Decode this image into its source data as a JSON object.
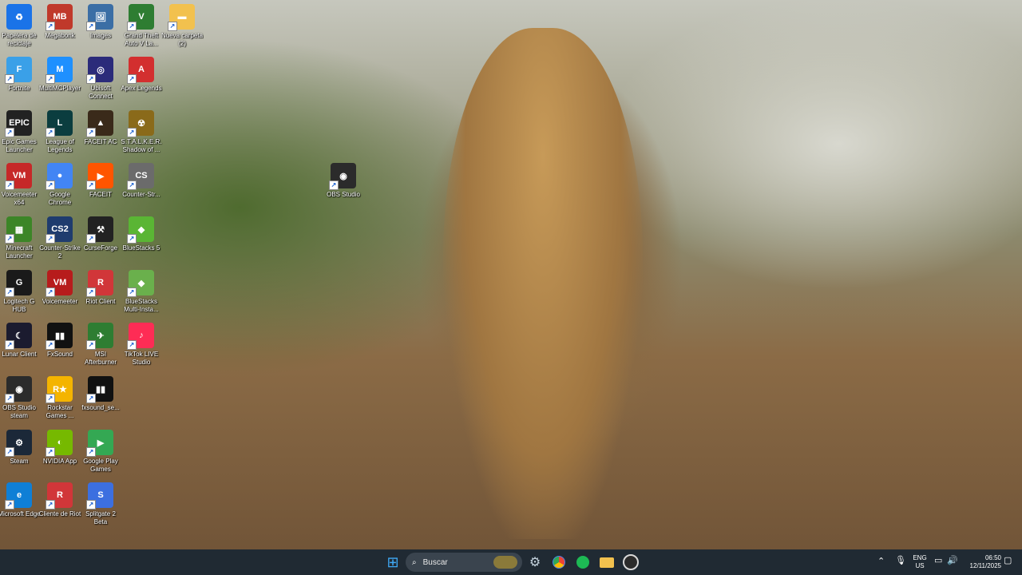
{
  "desktop": {
    "icons": [
      {
        "label": "Papelera de reciclaje",
        "icon": "recycle-bin-icon",
        "glyph": "♻",
        "color": "#1a73e8"
      },
      {
        "label": "Megabonk",
        "icon": "megabonk-icon",
        "glyph": "MB",
        "color": "#c0392b"
      },
      {
        "label": "Images",
        "icon": "images-icon",
        "glyph": "🖼",
        "color": "#3b6ea5"
      },
      {
        "label": "Grand Theft Auto V La...",
        "icon": "gta-icon",
        "glyph": "V",
        "color": "#2e7d32"
      },
      {
        "label": "Nueva carpeta (2)",
        "icon": "folder-icon",
        "glyph": "▬",
        "color": "#f2c14e"
      },
      {
        "label": "Fortnite",
        "icon": "fortnite-icon",
        "glyph": "F",
        "color": "#3aa0e8"
      },
      {
        "label": "MultiMCPlayer",
        "icon": "multimc-icon",
        "glyph": "M",
        "color": "#1e90ff"
      },
      {
        "label": "Ubisoft Connect",
        "icon": "ubisoft-icon",
        "glyph": "◎",
        "color": "#2b2b7a"
      },
      {
        "label": "Apex Legends",
        "icon": "apex-icon",
        "glyph": "A",
        "color": "#d32f2f"
      },
      {
        "label": "Epic Games Launcher",
        "icon": "epic-games-icon",
        "glyph": "EPIC",
        "color": "#222222"
      },
      {
        "label": "League of Legends",
        "icon": "league-icon",
        "glyph": "L",
        "color": "#0b3d3f"
      },
      {
        "label": "FACEIT AC",
        "icon": "faceit-ac-icon",
        "glyph": "▲",
        "color": "#3a2a1a"
      },
      {
        "label": "S.T.A.L.K.E.R. Shadow of ...",
        "icon": "stalker-icon",
        "glyph": "☢",
        "color": "#8a6a1a"
      },
      {
        "label": "Voicemeeter x64",
        "icon": "voicemeeter-icon",
        "glyph": "VM",
        "color": "#c62828"
      },
      {
        "label": "Google Chrome",
        "icon": "chrome-icon",
        "glyph": "●",
        "color": "#4285f4"
      },
      {
        "label": "FACEIT",
        "icon": "faceit-icon",
        "glyph": "▶",
        "color": "#ff5500"
      },
      {
        "label": "Counter-Str...",
        "icon": "counter-strike-icon",
        "glyph": "CS",
        "color": "#6b6b6b"
      },
      {
        "label": "Minecraft Launcher",
        "icon": "minecraft-icon",
        "glyph": "▦",
        "color": "#3c8527"
      },
      {
        "label": "Counter-Strike 2",
        "icon": "cs2-icon",
        "glyph": "CS2",
        "color": "#1f3c6e"
      },
      {
        "label": "CurseForge",
        "icon": "curseforge-icon",
        "glyph": "⚒",
        "color": "#222222"
      },
      {
        "label": "BlueStacks 5",
        "icon": "bluestacks-icon",
        "glyph": "◆",
        "color": "#5ab534"
      },
      {
        "label": "Logitech G HUB",
        "icon": "logitech-icon",
        "glyph": "G",
        "color": "#1a1a1a"
      },
      {
        "label": "Voicemeeter",
        "icon": "voicemeeter2-icon",
        "glyph": "VM",
        "color": "#b71c1c"
      },
      {
        "label": "Riot Client",
        "icon": "riot-client-icon",
        "glyph": "R",
        "color": "#d13639"
      },
      {
        "label": "BlueStacks Multi-Insta...",
        "icon": "bluestacks-multi-icon",
        "glyph": "◆",
        "color": "#6ab04c"
      },
      {
        "label": "Lunar Client",
        "icon": "lunar-client-icon",
        "glyph": "☾",
        "color": "#1b1b2f"
      },
      {
        "label": "FxSound",
        "icon": "fxsound-icon",
        "glyph": "▮▮",
        "color": "#111111"
      },
      {
        "label": "MSI Afterburner",
        "icon": "msi-afterburner-icon",
        "glyph": "✈",
        "color": "#2e7d32"
      },
      {
        "label": "TikTok LIVE Studio",
        "icon": "tiktok-icon",
        "glyph": "♪",
        "color": "#fe2c55"
      },
      {
        "label": "OBS Studio steam",
        "icon": "obs-steam-icon",
        "glyph": "◉",
        "color": "#2b2b2b"
      },
      {
        "label": "Rockstar Games ...",
        "icon": "rockstar-icon",
        "glyph": "R★",
        "color": "#f4b400"
      },
      {
        "label": "fxsound_se...",
        "icon": "fxsound-se-icon",
        "glyph": "▮▮",
        "color": "#111111"
      },
      {
        "label": "Steam",
        "icon": "steam-icon",
        "glyph": "⚙",
        "color": "#1b2838"
      },
      {
        "label": "NVIDIA App",
        "icon": "nvidia-icon",
        "glyph": "◐",
        "color": "#76b900"
      },
      {
        "label": "Google Play Games",
        "icon": "play-games-icon",
        "glyph": "▶",
        "color": "#34a853"
      },
      {
        "label": "Microsoft Edge",
        "icon": "edge-icon",
        "glyph": "e",
        "color": "#0f7fd6"
      },
      {
        "label": "Cliente de Riot",
        "icon": "riot-icon",
        "glyph": "R",
        "color": "#d13639"
      },
      {
        "label": "Splitgate 2 Beta",
        "icon": "splitgate-icon",
        "glyph": "S",
        "color": "#3c6fe0"
      },
      {
        "label": "OBS Studio",
        "icon": "obs-icon",
        "glyph": "◉",
        "color": "#2b2b2b"
      }
    ]
  },
  "taskbar": {
    "search_placeholder": "Buscar",
    "language": "ENG",
    "region": "US",
    "time": "06:50",
    "date": "12/11/2025",
    "pinned": [
      {
        "icon": "start-icon",
        "glyph": "⊞",
        "color": "#3fa9f5"
      },
      {
        "icon": "steam-taskbar-icon",
        "glyph": "⚙",
        "color": "#c7d5e0"
      },
      {
        "icon": "chrome-taskbar-icon",
        "glyph": "●",
        "color": "#4285f4"
      },
      {
        "icon": "spotify-icon",
        "glyph": "♫",
        "color": "#1db954"
      },
      {
        "icon": "file-explorer-icon",
        "glyph": "▬",
        "color": "#f2c14e"
      },
      {
        "icon": "obs-taskbar-icon",
        "glyph": "◉",
        "color": "#d8d8d8"
      }
    ],
    "tray": [
      {
        "icon": "chevron-up-icon",
        "glyph": "^"
      },
      {
        "icon": "microphone-icon",
        "glyph": "🎤"
      },
      {
        "icon": "display-icon",
        "glyph": "▭"
      },
      {
        "icon": "volume-icon",
        "glyph": "🔊"
      },
      {
        "icon": "notification-icon",
        "glyph": "▢"
      }
    ]
  }
}
